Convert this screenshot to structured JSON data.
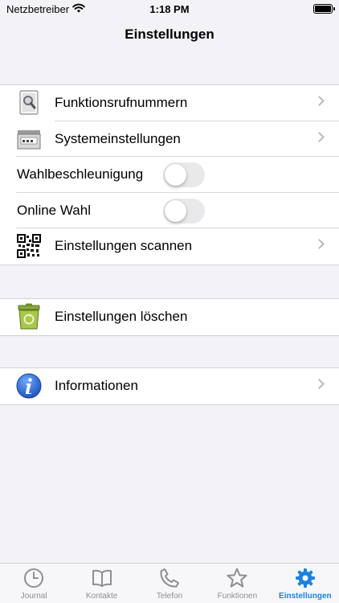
{
  "status": {
    "carrier": "Netzbetreiber",
    "time": "1:18 PM"
  },
  "nav": {
    "title": "Einstellungen"
  },
  "group1": {
    "items": [
      {
        "label": "Funktionsrufnummern",
        "icon": "document-search-icon"
      },
      {
        "label": "Systemeinstellungen",
        "icon": "phone-system-icon"
      },
      {
        "label": "Wahlbeschleunigung",
        "toggle": false
      },
      {
        "label": "Online Wahl",
        "toggle": false
      },
      {
        "label": "Einstellungen scannen",
        "icon": "qr-code-icon"
      }
    ]
  },
  "group2": {
    "items": [
      {
        "label": "Einstellungen löschen",
        "icon": "trash-icon"
      }
    ]
  },
  "group3": {
    "items": [
      {
        "label": "Informationen",
        "icon": "info-icon"
      }
    ]
  },
  "tabbar": {
    "tabs": [
      {
        "label": "Journal",
        "icon": "clock-icon"
      },
      {
        "label": "Kontakte",
        "icon": "book-icon"
      },
      {
        "label": "Telefon",
        "icon": "phone-icon"
      },
      {
        "label": "Funktionen",
        "icon": "star-icon"
      },
      {
        "label": "Einstellungen",
        "icon": "gear-icon",
        "active": true
      }
    ]
  },
  "colors": {
    "accent": "#1a82e0",
    "background": "#f2f2f7",
    "inactive": "#8e8e93"
  }
}
